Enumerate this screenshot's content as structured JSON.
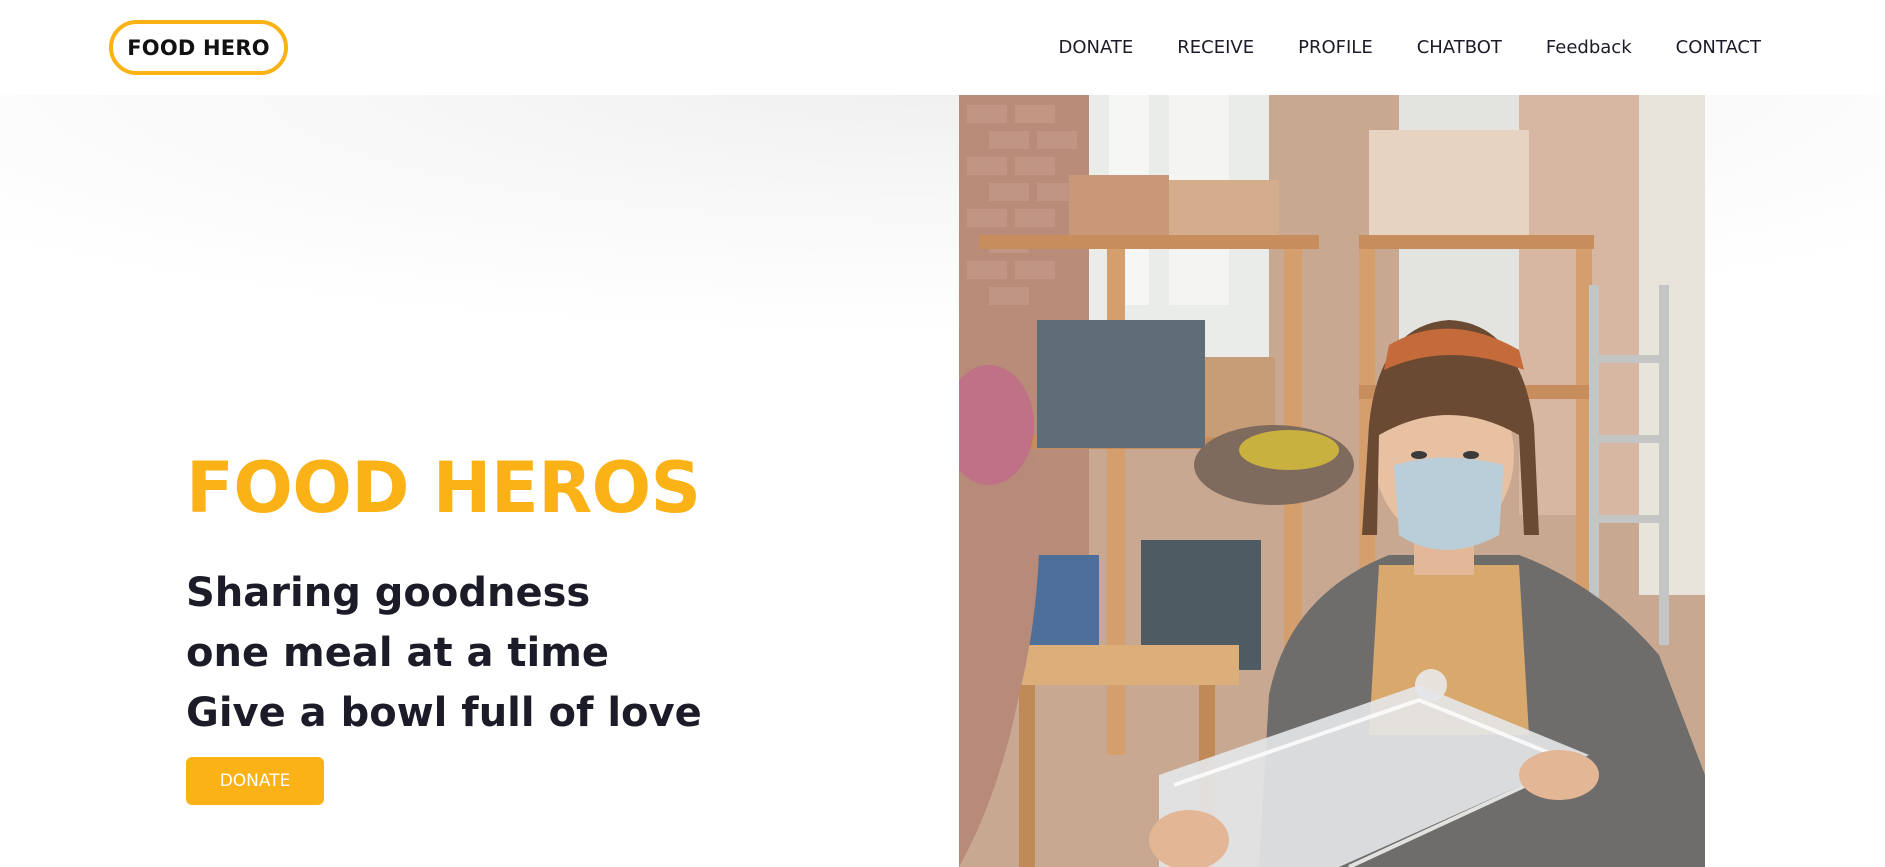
{
  "header": {
    "logo_text": "FOOD HERO",
    "nav": [
      {
        "label": "DONATE"
      },
      {
        "label": "RECEIVE"
      },
      {
        "label": "PROFILE"
      },
      {
        "label": "CHATBOT"
      },
      {
        "label": "Feedback"
      },
      {
        "label": "CONTACT"
      }
    ]
  },
  "hero": {
    "title": "FOOD HEROS",
    "tagline": [
      "Sharing goodness",
      "one meal at a time",
      "Give a bowl full of love"
    ],
    "cta_label": "DONATE"
  },
  "colors": {
    "accent": "#fbb216",
    "text_dark": "#1c1c28",
    "background": "#ffffff"
  }
}
